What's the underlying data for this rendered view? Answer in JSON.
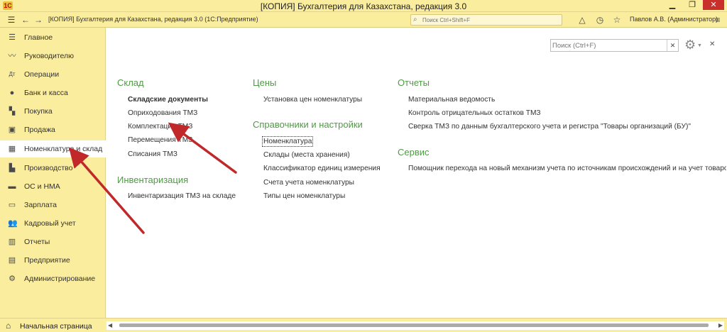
{
  "window": {
    "title": "[КОПИЯ] Бухгалтерия для Казахстана, редакция 3.0",
    "logo_text": "1С"
  },
  "toolbar": {
    "app_title": "[КОПИЯ] Бухгалтерия для Казахстана, редакция 3.0  (1С:Предприятие)",
    "search_placeholder": "Поиск Ctrl+Shift+F",
    "user": "Павлов А.В. (Администратор)"
  },
  "sidebar": {
    "items": [
      {
        "label": "Главное",
        "icon": "list-icon"
      },
      {
        "label": "Руководителю",
        "icon": "chart-icon"
      },
      {
        "label": "Операции",
        "icon": "dt-kt-icon"
      },
      {
        "label": "Банк и касса",
        "icon": "money-icon"
      },
      {
        "label": "Покупка",
        "icon": "cart-icon"
      },
      {
        "label": "Продажа",
        "icon": "bag-icon"
      },
      {
        "label": "Номенклатура и склад",
        "icon": "grid-icon"
      },
      {
        "label": "Производство",
        "icon": "factory-icon"
      },
      {
        "label": "ОС и НМА",
        "icon": "truck-icon"
      },
      {
        "label": "Зарплата",
        "icon": "wallet-icon"
      },
      {
        "label": "Кадровый учет",
        "icon": "people-icon"
      },
      {
        "label": "Отчеты",
        "icon": "bar-chart-icon"
      },
      {
        "label": "Предприятие",
        "icon": "building-icon"
      },
      {
        "label": "Администрирование",
        "icon": "gear-icon"
      }
    ],
    "active_index": 6
  },
  "bottombar": {
    "home_label": "Начальная страница"
  },
  "main": {
    "search_placeholder": "Поиск (Ctrl+F)",
    "sklad": {
      "title": "Склад",
      "links": [
        "Складские документы",
        "Оприходования ТМЗ",
        "Комплектации ТМЗ",
        "Перемещения ТМЗ",
        "Списания ТМЗ"
      ]
    },
    "inventarizatsiya": {
      "title": "Инвентаризация",
      "links": [
        "Инвентаризация ТМЗ на складе"
      ]
    },
    "tseny": {
      "title": "Цены",
      "links": [
        "Установка цен номенклатуры"
      ]
    },
    "spravochniki": {
      "title": "Справочники и настройки",
      "links": [
        "Номенклатура",
        "Склады (места хранения)",
        "Классификатор единиц измерения",
        "Счета учета номенклатуры",
        "Типы цен номенклатуры"
      ]
    },
    "otchety": {
      "title": "Отчеты",
      "links": [
        "Материальная ведомость",
        "Контроль отрицательных остатков ТМЗ",
        "Сверка ТМЗ по данным бухгалтерского учета и регистра \"Товары организаций (БУ)\""
      ]
    },
    "servis": {
      "title": "Сервис",
      "links": [
        "Помощник перехода на новый механизм учета по источникам происхождений и на учет товаров Е"
      ]
    }
  }
}
